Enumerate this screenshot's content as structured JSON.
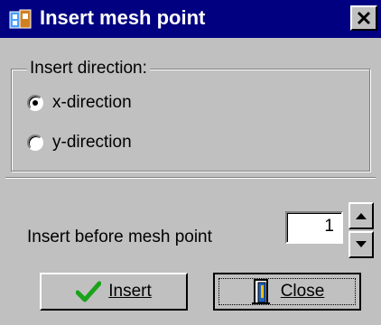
{
  "window": {
    "title": "Insert mesh point",
    "close_button_glyph": "✕"
  },
  "direction_group": {
    "legend": "Insert direction:",
    "options": [
      {
        "label": "x-direction",
        "selected": true
      },
      {
        "label": "y-direction",
        "selected": false
      }
    ]
  },
  "position": {
    "label": "Insert before mesh point",
    "value": "1"
  },
  "buttons": {
    "insert_label": "Insert",
    "insert_icon": "green-checkmark-icon",
    "close_label": "Close",
    "close_icon": "door-exit-icon"
  },
  "colors": {
    "title_bar": "#000080",
    "face": "#c0c0c0",
    "check": "#1aa31a"
  }
}
